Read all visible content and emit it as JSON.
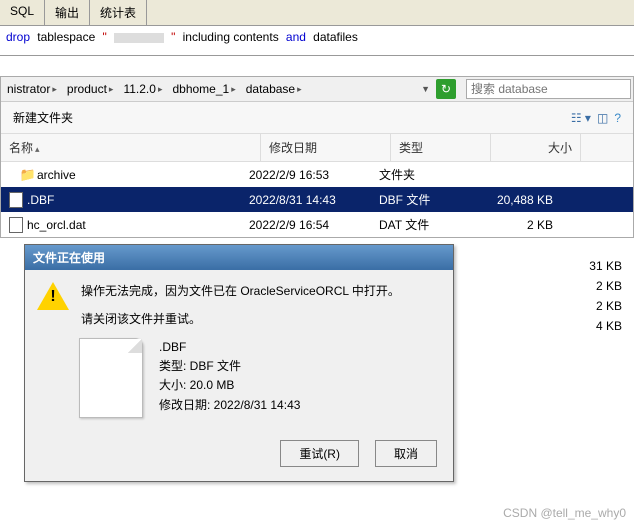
{
  "tabs": {
    "sql": "SQL",
    "output": "输出",
    "stats": "统计表"
  },
  "sql_query": {
    "part1": "drop",
    "part2": "tablespace",
    "part3": "\"",
    "part4": "\"",
    "part5": "including contents",
    "part6": "and",
    "part7": "datafiles"
  },
  "breadcrumb": [
    "nistrator",
    "product",
    "11.2.0",
    "dbhome_1",
    "database"
  ],
  "search": {
    "placeholder": "搜索 database"
  },
  "toolbar": {
    "new_folder": "新建文件夹"
  },
  "columns": {
    "name": "名称",
    "date": "修改日期",
    "type": "类型",
    "size": "大小"
  },
  "files": [
    {
      "name": "archive",
      "date": "2022/2/9 16:53",
      "type": "文件夹",
      "size": ""
    },
    {
      "name": ".DBF",
      "date": "2022/8/31 14:43",
      "type": "DBF 文件",
      "size": "20,488 KB"
    },
    {
      "name": "hc_orcl.dat",
      "date": "2022/2/9 16:54",
      "type": "DAT 文件",
      "size": "2 KB"
    }
  ],
  "hidden_sizes": [
    "31 KB",
    "2 KB",
    "2 KB",
    "4 KB"
  ],
  "dialog": {
    "title": "文件正在使用",
    "message_line1": "操作无法完成，因为文件已在 OracleServiceORCL 中打开。",
    "message_line2": "请关闭该文件并重试。",
    "file_name": ".DBF",
    "file_type": "类型: DBF 文件",
    "file_size": "大小: 20.0 MB",
    "file_date": "修改日期: 2022/8/31 14:43",
    "retry": "重试(R)",
    "cancel": "取消"
  },
  "watermark": "CSDN @tell_me_why0"
}
